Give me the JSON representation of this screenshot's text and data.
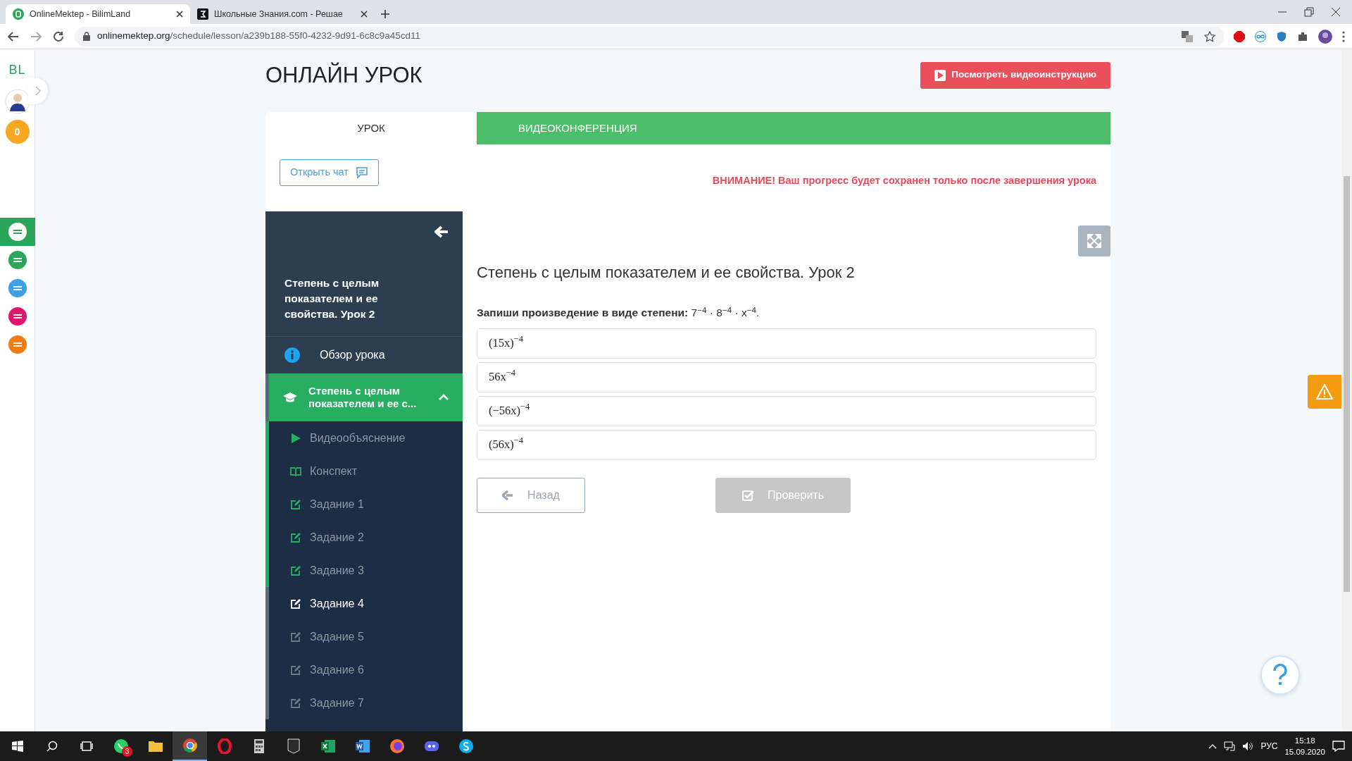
{
  "browser": {
    "tabs": [
      {
        "title": "OnlineMektep - BilimLand",
        "selected": true
      },
      {
        "title": "Школьные Знания.com - Решае",
        "selected": false
      }
    ],
    "url_host": "onlinemektep.org",
    "url_path": "/schedule/lesson/a239b188-55f0-4232-9d91-6c8c9a45cd11"
  },
  "rail": {
    "logo": "BL",
    "coins": "0",
    "apps": [
      {
        "selected": true
      },
      {
        "selected": false
      },
      {
        "selected": false
      },
      {
        "selected": false
      },
      {
        "selected": false
      }
    ]
  },
  "page_title": "ОНЛАЙН УРОК",
  "video_button": "Посмотреть видеоинструкцию",
  "tabs": [
    {
      "label": "УРОК",
      "selected": true
    },
    {
      "label": "ВИДЕОКОНФЕРЕНЦИЯ",
      "selected": false
    }
  ],
  "chat_button": "Открыть чат",
  "warning": "ВНИМАНИЕ! Ваш прогресс будет сохранен только после завершения урока",
  "sidebar": {
    "title": "Степень с целым показателем и ее свойства. Урок 2",
    "overview": "Обзор урока",
    "section": {
      "title": "Степень с целым показателем и ее с...",
      "expanded": true
    },
    "items": [
      {
        "kind": "video",
        "label": "Видеообъяснение",
        "done": true,
        "selected": false
      },
      {
        "kind": "notes",
        "label": "Конспект",
        "done": true,
        "selected": false
      },
      {
        "kind": "task",
        "label": "Задание 1",
        "done": true,
        "selected": false
      },
      {
        "kind": "task",
        "label": "Задание 2",
        "done": true,
        "selected": false
      },
      {
        "kind": "task",
        "label": "Задание 3",
        "done": true,
        "selected": false
      },
      {
        "kind": "task",
        "label": "Задание 4",
        "done": false,
        "selected": true
      },
      {
        "kind": "task",
        "label": "Задание 5",
        "done": false,
        "selected": false
      },
      {
        "kind": "task",
        "label": "Задание 6",
        "done": false,
        "selected": false
      },
      {
        "kind": "task",
        "label": "Задание 7",
        "done": false,
        "selected": false
      }
    ]
  },
  "lesson": {
    "title": "Степень с целым показателем и ее свойства. Урок 2",
    "question": "**Запиши произведение в виде степени:** 7$^{−4}$ · 8$^{−4}$ · x$^{−4}$.",
    "options": [
      {
        "text": "(15x)$^{−4}$",
        "selected": false
      },
      {
        "text": "56x$^{−4}$",
        "selected": false
      },
      {
        "text": "(−56x)$^{−4}$",
        "selected": false
      },
      {
        "text": "(56x)$^{−4}$",
        "selected": false
      }
    ],
    "back_button": "Назад",
    "check_button": {
      "label": "Проверить",
      "disabled": true
    }
  },
  "taskbar": {
    "apps": [
      {
        "kind": "whatsapp",
        "active": false,
        "badge": "3"
      },
      {
        "kind": "folder",
        "active": false
      },
      {
        "kind": "chrome",
        "active": true
      },
      {
        "kind": "opera",
        "active": false
      },
      {
        "kind": "calculator",
        "active": false
      },
      {
        "kind": "epic",
        "active": false
      },
      {
        "kind": "excel",
        "active": false
      },
      {
        "kind": "word",
        "active": false
      },
      {
        "kind": "firefox",
        "active": false
      },
      {
        "kind": "discord",
        "active": false
      },
      {
        "kind": "skype",
        "active": false
      }
    ],
    "language": "РУС",
    "time": "15:18",
    "date": "15.09.2020"
  }
}
